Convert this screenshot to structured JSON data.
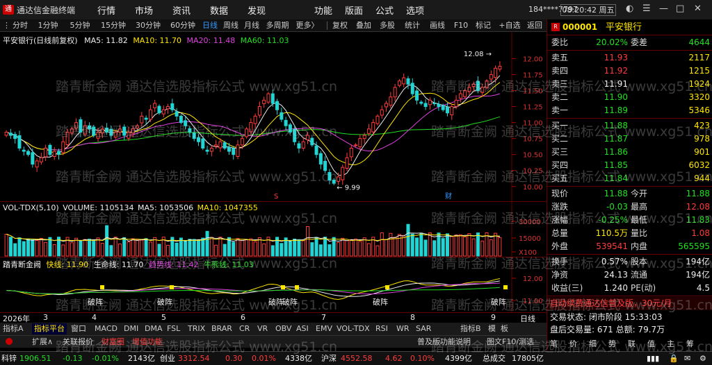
{
  "window": {
    "app_title": "通达信金融终端",
    "user": "184****7797",
    "clock": "08:20:42 周五"
  },
  "menu": [
    "行情",
    "市场",
    "资讯",
    "数据",
    "发现",
    "功能",
    "版面",
    "公式",
    "选项"
  ],
  "toolbar_left": [
    "分时",
    "1分钟",
    "5分钟",
    "15分钟",
    "30分钟",
    "60分钟",
    "日线",
    "周线",
    "月线",
    "多周期",
    "更多〉"
  ],
  "toolbar_right": [
    "复权",
    "叠加",
    "多股",
    "统计",
    "画线",
    "F10",
    "标记",
    "+自选",
    "返回"
  ],
  "main_legend": {
    "name": "平安银行(日线前复权)",
    "ma5": "MA5: 11.82",
    "ma10": "MA10: 11.70",
    "ma20": "MA20: 11.48",
    "ma60": "MA60: 11.03"
  },
  "vol_legend": {
    "name": "VOL-TDX(5,10)",
    "volume": "VOLUME: 1105134",
    "ma5": "MA5: 1053506",
    "ma10": "MA10: 1047355"
  },
  "ind_legend": {
    "name": "踏青断金阙",
    "kuai": "快线: 11.90",
    "shengming": "生命线: 11.70",
    "qushi": "趋势线: 11.42",
    "niuxiong": "牛熊线: 11.03"
  },
  "axis_dates": [
    "2026年",
    "3",
    "4",
    "5",
    "6",
    "7",
    "8",
    "9"
  ],
  "axis_right_label": "日线",
  "tabs": [
    "指标A",
    "指标平台",
    "窗口",
    "MACD",
    "DMI",
    "DMA",
    "FSL",
    "TRIX",
    "BRAR",
    "CR",
    "VR",
    "OBV",
    "ASI",
    "EMV",
    "VOL-TDX",
    "RSI",
    "WR",
    "SAR",
    "指标B",
    "模",
    "板"
  ],
  "subbar": [
    "扩展∧",
    "关联报价",
    "财富圈",
    "增值功能"
  ],
  "subbar_right": "普及版功能说明",
  "subbar_right2": "图文F10/测选",
  "stock": {
    "code": "000001",
    "name": "平安银行"
  },
  "wei": {
    "weibi_label": "委比",
    "weibi": "20.02%",
    "weicha_label": "委差",
    "weicha": "4644"
  },
  "asks": [
    {
      "label": "卖五",
      "price": "11.93",
      "vol": "2117"
    },
    {
      "label": "卖四",
      "price": "11.92",
      "vol": "1215"
    },
    {
      "label": "卖三",
      "price": "11.91",
      "vol": "1924"
    },
    {
      "label": "卖二",
      "price": "11.90",
      "vol": "3320"
    },
    {
      "label": "卖一",
      "price": "11.89",
      "vol": "5346"
    }
  ],
  "bids": [
    {
      "label": "买一",
      "price": "11.88",
      "vol": "423"
    },
    {
      "label": "买二",
      "price": "11.87",
      "vol": "978"
    },
    {
      "label": "买三",
      "price": "11.86",
      "vol": "901"
    },
    {
      "label": "买四",
      "price": "11.85",
      "vol": "6032"
    },
    {
      "label": "买五",
      "price": "11.84",
      "vol": "944"
    }
  ],
  "quote": [
    {
      "l1": "现价",
      "v1": "11.88",
      "l2": "今开",
      "v2": "11.88"
    },
    {
      "l1": "涨跌",
      "v1": "-0.03",
      "l2": "最高",
      "v2": "12.08"
    },
    {
      "l1": "涨幅",
      "v1": "-0.25%",
      "l2": "最低",
      "v2": "11.83"
    },
    {
      "l1": "总量",
      "v1": "110.5万",
      "l2": "量比",
      "v2": "1.08"
    },
    {
      "l1": "外盘",
      "v1": "539541",
      "l2": "内盘",
      "v2": "565595"
    }
  ],
  "fin": [
    {
      "l1": "换手",
      "v1": "0.57%",
      "l2": "股本",
      "v2": "194亿"
    },
    {
      "l1": "净资",
      "v1": "24.13",
      "l2": "流通",
      "v2": "194亿"
    },
    {
      "l1": "收益(三)",
      "v1": "1.240",
      "l2": "PE(动)",
      "v2": "4.5"
    }
  ],
  "ad": "自动续费通达信普及版，30元/月",
  "trade": {
    "status": "交易状态: 闭市阶段 15:33:03",
    "after": "盘后交易量: 671 总额: 79.7万"
  },
  "bottom_tabs": [
    "笔",
    "价",
    "细",
    "势",
    "联",
    "值",
    "主",
    "筹"
  ],
  "statusbar": [
    {
      "name": "科锌",
      "val": "1906.51",
      "chg": "-0.13",
      "pct": "-0.01%",
      "amt": "2143亿"
    },
    {
      "name": "创业",
      "val": "3312.54",
      "chg": "0.30",
      "pct": "0.01%",
      "amt": "4338亿"
    },
    {
      "name": "沪深",
      "val": "4552.58",
      "chg": "4.62",
      "pct": "0.10%",
      "amt": "4399亿"
    },
    {
      "name": "总成交",
      "val": "17805亿",
      "chg": "",
      "pct": "",
      "amt": ""
    }
  ],
  "watermarks": [
    "踏青断金阙 通达信选股指标公式 www.xg51.cn"
  ],
  "chart_data": [
    {
      "type": "candlestick",
      "title": "平安银行(日线前复权)",
      "ylim": [
        9.9,
        12.2
      ],
      "yticks": [
        "12.00",
        "11.75",
        "11.50",
        "11.25",
        "11.00",
        "10.75",
        "10.50",
        "10.25",
        "10.00"
      ],
      "annotations": [
        "12.08",
        "9.99"
      ],
      "markers": [
        "S",
        "财"
      ],
      "series_ma": [
        "MA5",
        "MA10",
        "MA20",
        "MA60"
      ],
      "closes": [
        10.85,
        10.8,
        10.75,
        10.6,
        10.55,
        10.5,
        10.35,
        10.4,
        10.45,
        10.6,
        10.5,
        10.55,
        10.5,
        10.7,
        10.85,
        10.9,
        11.0,
        10.85,
        10.95,
        10.9,
        10.8,
        10.85,
        10.9,
        10.85,
        10.8,
        10.85,
        10.9,
        10.8,
        10.85,
        10.9,
        10.95,
        11.1,
        11.05,
        11.2,
        11.3,
        11.15,
        11.2,
        11.25,
        11.2,
        11.1,
        11.0,
        10.95,
        10.85,
        10.75,
        10.7,
        10.6,
        10.55,
        10.6,
        10.65,
        10.7,
        10.6,
        10.55,
        10.5,
        10.65,
        10.75,
        10.9,
        11.0,
        11.1,
        11.25,
        11.35,
        11.45,
        11.3,
        11.2,
        11.05,
        10.95,
        10.85,
        10.7,
        10.6,
        10.7,
        10.8,
        10.65,
        10.5,
        10.35,
        10.25,
        10.1,
        10.05,
        10.15,
        10.3,
        10.45,
        10.6,
        10.65,
        10.75,
        10.8,
        10.9,
        11.0,
        11.1,
        11.2,
        11.3,
        11.4,
        11.55,
        11.65,
        11.7,
        11.6,
        11.45,
        11.35,
        11.3,
        11.25,
        11.35,
        11.3,
        11.25,
        11.2,
        11.15,
        11.25,
        11.35,
        11.45,
        11.5,
        11.55,
        11.6,
        11.5,
        11.55,
        11.65,
        11.75,
        11.85,
        11.88
      ]
    },
    {
      "type": "bar",
      "title": "VOL-TDX(5,10)",
      "yticks": [
        "30000",
        "15000",
        "X100"
      ]
    },
    {
      "type": "line",
      "title": "踏青断金阙",
      "yticks": [
        "12.00",
        "11.00"
      ],
      "labels": [
        "破阵",
        "破阵",
        "破阵",
        "破阵",
        "破阵",
        "破阵"
      ]
    }
  ]
}
